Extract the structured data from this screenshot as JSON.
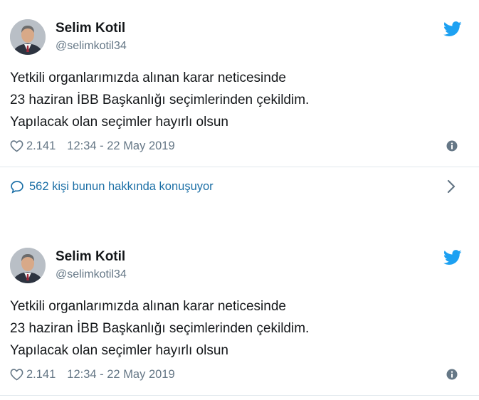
{
  "tweets": [
    {
      "author_name": "Selim Kotil",
      "author_handle": "@selimkotil34",
      "text_lines": [
        "Yetkili organlarımızda alınan karar neticesinde",
        "23 haziran İBB Başkanlığı seçimlerinden çekildim.",
        "Yapılacak olan seçimler hayırlı olsun"
      ],
      "likes": "2.141",
      "timestamp": "12:34 - 22 May 2019",
      "conversation": "562 kişi bunun hakkında konuşuyor"
    },
    {
      "author_name": "Selim Kotil",
      "author_handle": "@selimkotil34",
      "text_lines": [
        "Yetkili organlarımızda alınan karar neticesinde",
        "23 haziran İBB Başkanlığı seçimlerinden çekildim.",
        "Yapılacak olan seçimler hayırlı olsun"
      ],
      "likes": "2.141",
      "timestamp": "12:34 - 22 May 2019"
    }
  ],
  "colors": {
    "twitter_blue": "#1da1f2",
    "link": "#1b6fa6",
    "muted": "#657786",
    "text": "#14171a",
    "divider": "#e1e8ed"
  },
  "icons": [
    "twitter-bird-icon",
    "heart-icon",
    "info-icon",
    "speech-bubble-icon",
    "chevron-right-icon"
  ]
}
